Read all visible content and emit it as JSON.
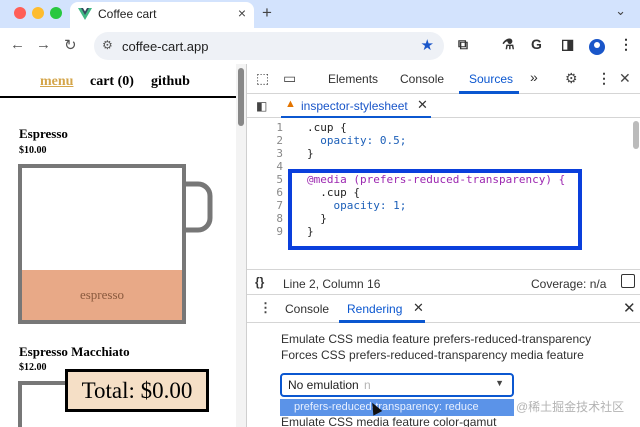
{
  "browser": {
    "tab_title": "Coffee cart",
    "tab_close": "×",
    "new_tab": "+",
    "tab_menu": "⌄",
    "url": "coffee-cart.app",
    "nav_back": "←",
    "nav_forward": "→",
    "nav_reload": "↻",
    "toolbar_icons": {
      "extensions": "⧉",
      "labs": "⚗",
      "google": "G",
      "sidebar": "◨",
      "menu": "⋮"
    }
  },
  "page": {
    "nav": {
      "menu": "menu",
      "cart": "cart (0)",
      "github": "github"
    },
    "products": [
      {
        "name": "Espresso",
        "price": "$10.00",
        "cup_label": "espresso"
      },
      {
        "name": "Espresso Macchiato",
        "price": "$12.00"
      }
    ],
    "total": "Total: $0.00"
  },
  "devtools": {
    "tabs": {
      "elements": "Elements",
      "console": "Console",
      "sources": "Sources",
      "more": "»"
    },
    "file_tab": "inspector-stylesheet",
    "code_lines": [
      {
        "n": "1",
        "text": ".cup {"
      },
      {
        "n": "2",
        "text": "  opacity: 0.5;"
      },
      {
        "n": "3",
        "text": "}"
      },
      {
        "n": "4",
        "text": ""
      },
      {
        "n": "5",
        "text": "@media (prefers-reduced-transparency) {"
      },
      {
        "n": "6",
        "text": "  .cup {"
      },
      {
        "n": "7",
        "text": "    opacity: 1;"
      },
      {
        "n": "8",
        "text": "  }"
      },
      {
        "n": "9",
        "text": "}"
      }
    ],
    "status": {
      "braces": "{}",
      "position": "Line 2, Column 16",
      "coverage": "Coverage: n/a"
    },
    "drawer": {
      "console": "Console",
      "rendering": "Rendering"
    },
    "rendering": {
      "title": "Emulate CSS media feature prefers-reduced-transparency",
      "description": "Forces CSS prefers-reduced-transparency media feature",
      "selected": "No emulation",
      "ghost": "n",
      "option": "prefers-reduced-transparency: reduce",
      "next_title": "Emulate CSS media feature color-gamut"
    }
  },
  "watermark": "@稀土掘金技术社区",
  "colors": {
    "accent": "#0b57d0",
    "highlight_box": "#0a3fdc",
    "menu_link": "#d4a54a",
    "coffee": "#e8a987"
  }
}
